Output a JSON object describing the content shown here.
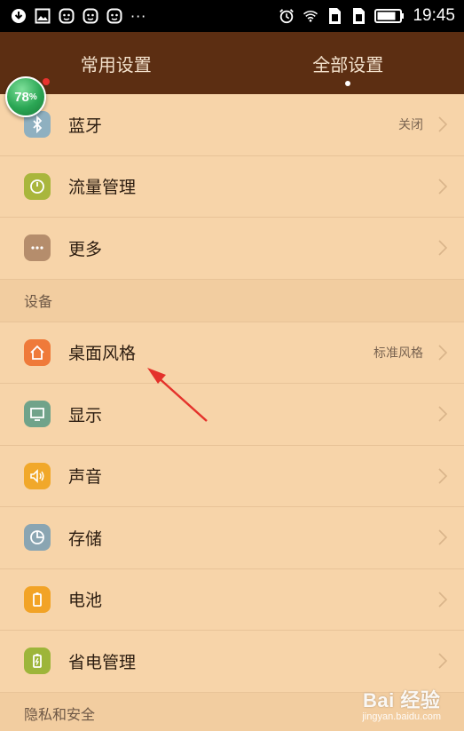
{
  "status_bar": {
    "left_icons": [
      "download-icon",
      "image-icon",
      "app-icon",
      "app-icon",
      "app-icon"
    ],
    "more": "···",
    "right_icons": [
      "alarm-icon",
      "wifi-icon",
      "sim1-icon",
      "sim2-icon",
      "battery-icon"
    ],
    "time": "19:45"
  },
  "tabs": [
    {
      "label": "常用设置",
      "active": false
    },
    {
      "label": "全部设置",
      "active": true
    }
  ],
  "floating_badge": {
    "value": "78",
    "unit": "%"
  },
  "rows_top": [
    {
      "label": "蓝牙",
      "value": "关闭",
      "icon": "bluetooth-icon",
      "color": "#8fb0c0"
    },
    {
      "label": "流量管理",
      "value": "",
      "icon": "data-usage-icon",
      "color": "#a9b63c"
    },
    {
      "label": "更多",
      "value": "",
      "icon": "more-icon",
      "color": "#b58d6c"
    }
  ],
  "section_device": "设备",
  "rows_device": [
    {
      "label": "桌面风格",
      "value": "标准风格",
      "icon": "home-icon",
      "color": "#ef7a3a"
    },
    {
      "label": "显示",
      "value": "",
      "icon": "display-icon",
      "color": "#70a38a"
    },
    {
      "label": "声音",
      "value": "",
      "icon": "speaker-icon",
      "color": "#f1a82a"
    },
    {
      "label": "存储",
      "value": "",
      "icon": "storage-icon",
      "color": "#8aa5b2"
    },
    {
      "label": "电池",
      "value": "",
      "icon": "battery-icon",
      "color": "#f2a326"
    },
    {
      "label": "省电管理",
      "value": "",
      "icon": "power-saving-icon",
      "color": "#9db53a"
    }
  ],
  "section_privacy": "隐私和安全",
  "watermark": {
    "logo": "Bai 经验",
    "url": "jingyan.baidu.com"
  },
  "colors": {
    "header": "#5c2e12",
    "background": "#f7d4a9",
    "arrow": "#e4322b"
  }
}
